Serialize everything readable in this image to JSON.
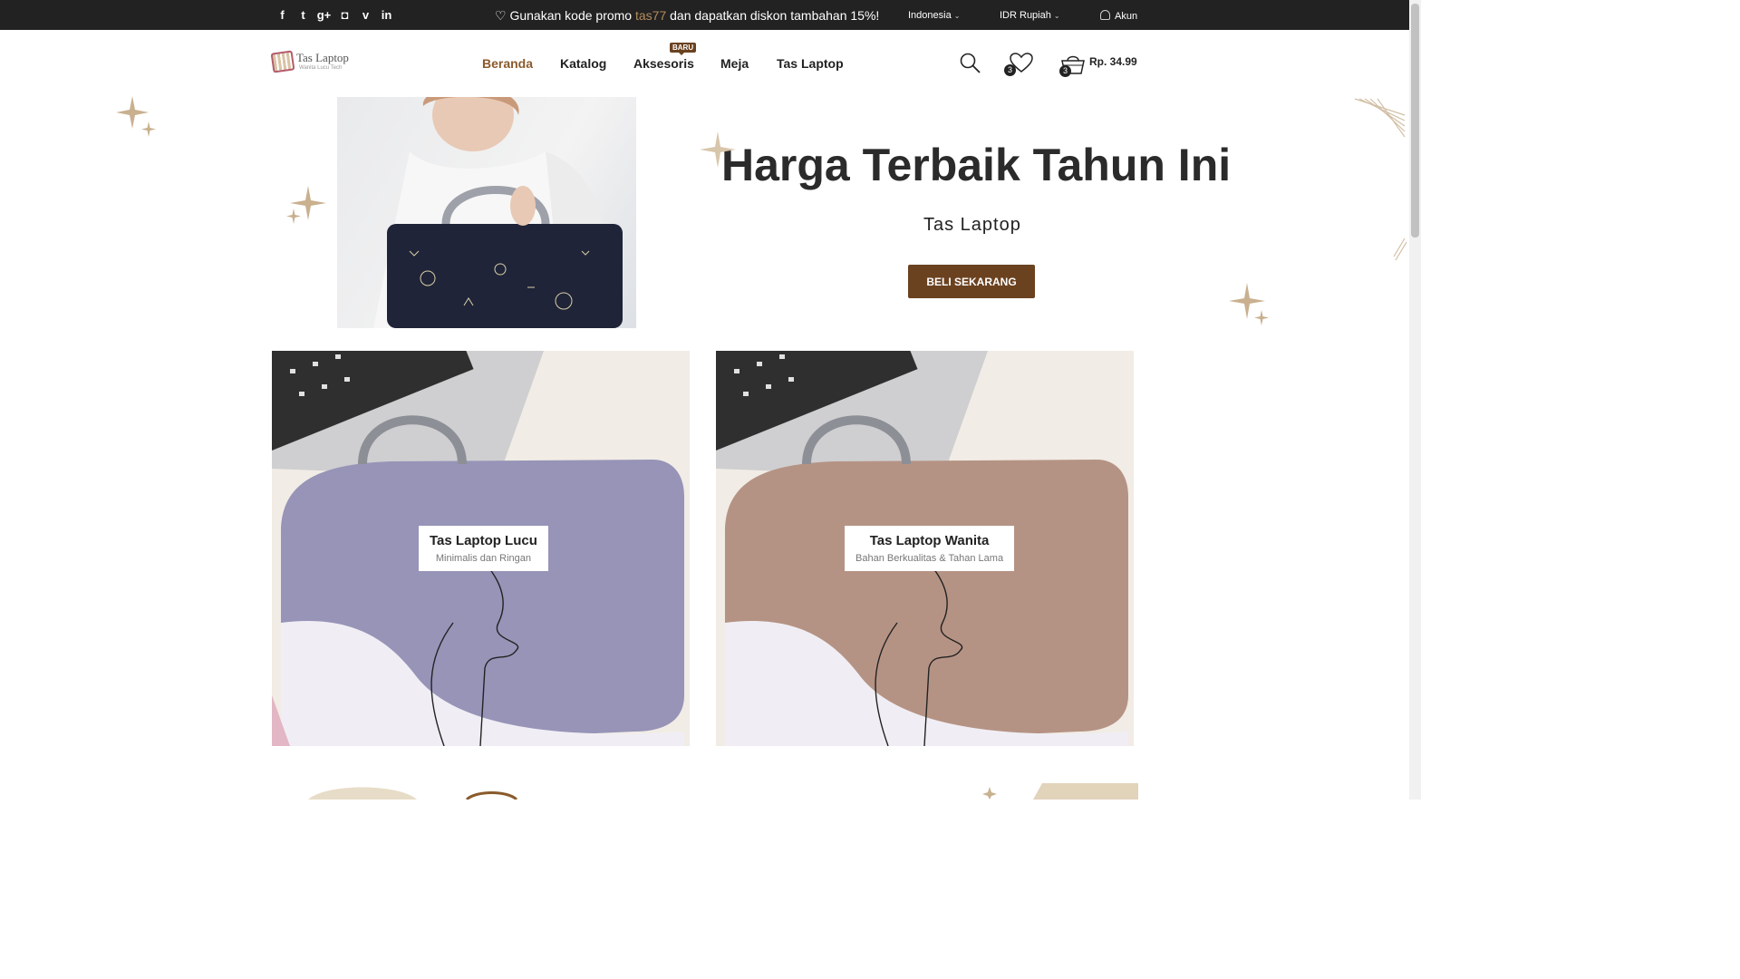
{
  "topbar": {
    "social": [
      {
        "icon": "facebook-icon",
        "glyph": "f"
      },
      {
        "icon": "twitter-icon",
        "glyph": "t"
      },
      {
        "icon": "google-plus-icon",
        "glyph": "g+"
      },
      {
        "icon": "instagram-icon",
        "glyph": "◘"
      },
      {
        "icon": "vimeo-icon",
        "glyph": "v"
      },
      {
        "icon": "linkedin-icon",
        "glyph": "in"
      }
    ],
    "promo_prefix": "Gunakan kode promo",
    "promo_code": "tas77",
    "promo_suffix": "dan dapatkan diskon tambahan 15%!",
    "language": "Indonesia",
    "currency": "IDR Rupiah",
    "account": "Akun"
  },
  "header": {
    "logo_name": "Tas Laptop",
    "logo_tagline": "Wanita Lucu Tech",
    "nav": [
      "Beranda",
      "Katalog",
      "Aksesoris",
      "Meja",
      "Tas Laptop"
    ],
    "new_badge": "BARU",
    "wishlist_count": "3",
    "cart_count": "3",
    "cart_total": "Rp. 34.99"
  },
  "hero": {
    "title": "Harga Terbaik Tahun Ini",
    "subtitle": "Tas Laptop",
    "button": "BELI SEKARANG"
  },
  "banners": [
    {
      "title": "Tas Laptop Lucu",
      "desc": "Minimalis dan Ringan",
      "bag_color": "#9794b8"
    },
    {
      "title": "Tas Laptop Wanita",
      "desc": "Bahan Berkualitas & Tahan Lama",
      "bag_color": "#b59384"
    }
  ],
  "colors": {
    "accent": "#6b4220",
    "active_nav": "#8a5a2b",
    "topbar": "#222222",
    "promo_code": "#b28b5e",
    "sparkle": "#c9b08f"
  }
}
